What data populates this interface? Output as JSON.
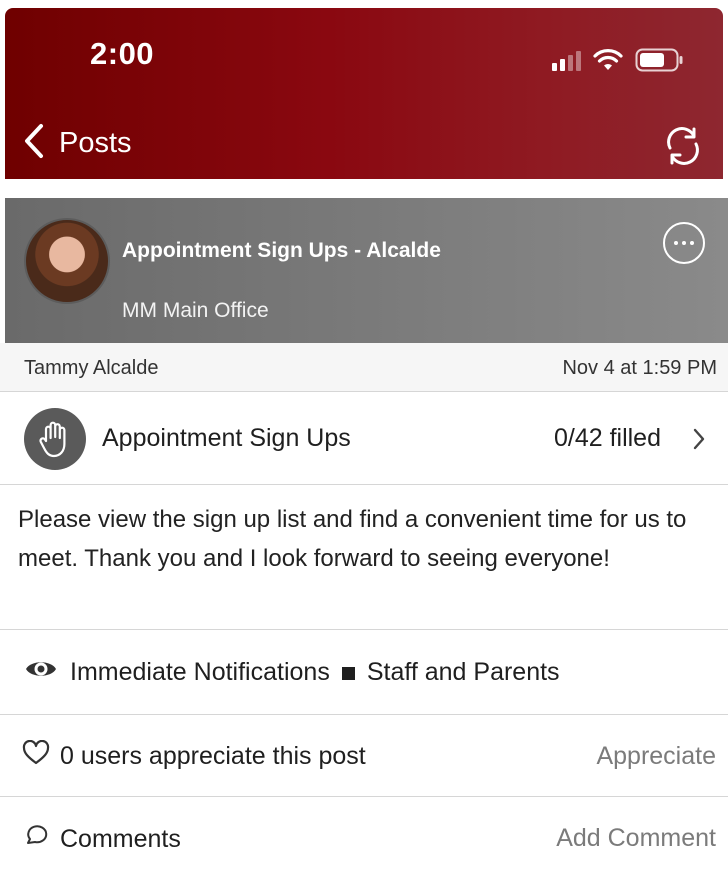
{
  "status_bar": {
    "time": "2:00",
    "icons": [
      "signal-icon",
      "wifi-icon",
      "battery-icon"
    ]
  },
  "nav": {
    "back_label": "Posts",
    "back_icon": "chevron-left-icon",
    "refresh_icon": "refresh-icon"
  },
  "post": {
    "title": "Appointment Sign Ups - Alcalde",
    "office": "MM Main Office",
    "more_icon": "ellipsis-icon",
    "author": "Tammy Alcalde",
    "date": "Nov 4 at 1:59 PM",
    "signup": {
      "label": "Appointment Sign Ups",
      "count": "0/42 filled",
      "icon": "hand-icon"
    },
    "body": "Please view the sign up list and find a convenient time for us to meet. Thank you and I look forward to seeing everyone!",
    "notification": {
      "type": "Immediate Notifications",
      "audience": "Staff and Parents",
      "icon": "eye-icon"
    },
    "appreciate": {
      "text": "0 users appreciate this post",
      "action": "Appreciate",
      "icon": "heart-icon"
    },
    "comments": {
      "label": "Comments",
      "action": "Add Comment",
      "icon": "comment-icon"
    }
  },
  "colors": {
    "header_start": "#6f0000",
    "header_end": "#8e2730",
    "banner": "#7a7a7a",
    "muted_text": "#7b7b7b"
  }
}
